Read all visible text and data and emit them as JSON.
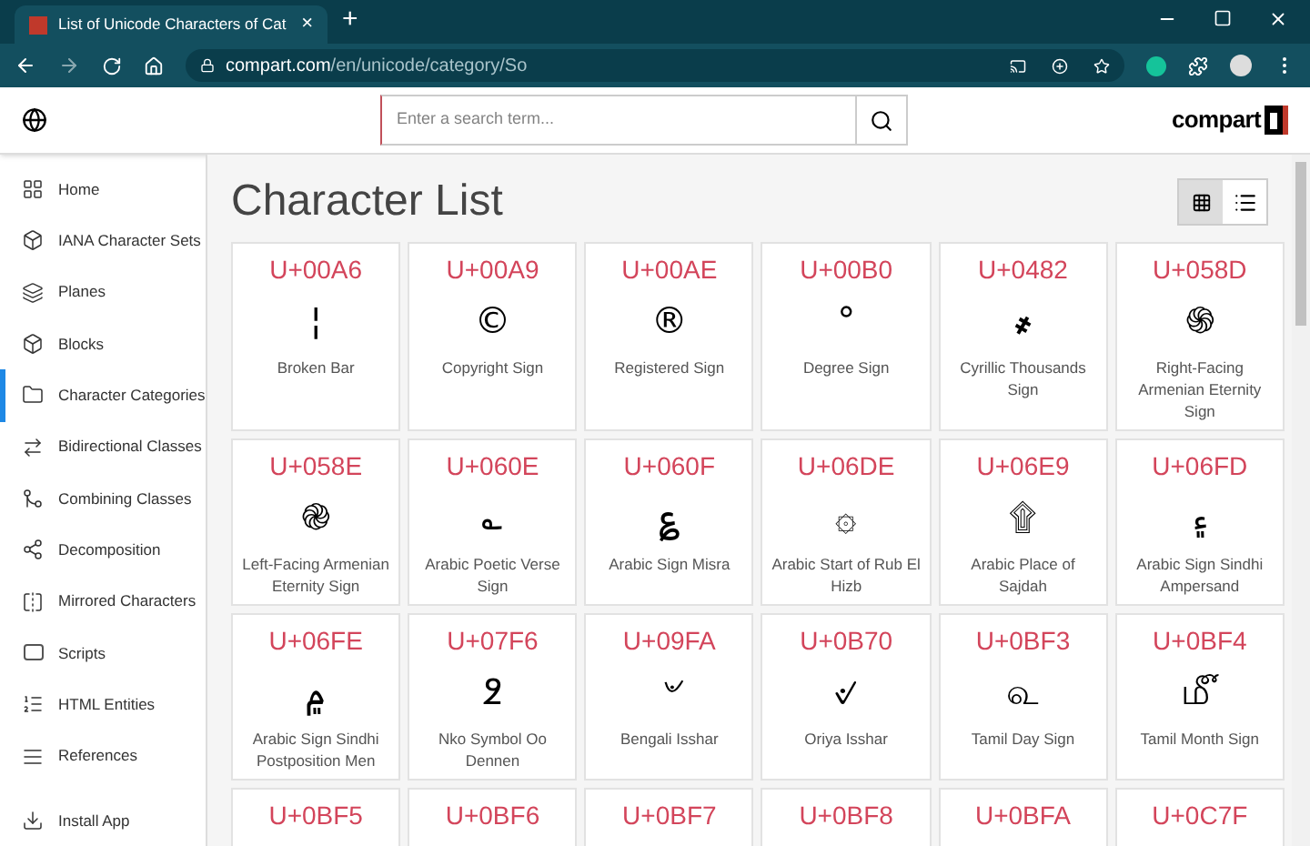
{
  "browser": {
    "tab_title": "List of Unicode Characters of Cat",
    "tab_close": "×",
    "new_tab": "+",
    "url_host": "compart.com",
    "url_path": "/en/unicode/category/So"
  },
  "header": {
    "search": {
      "placeholder": "Enter a search term..."
    },
    "logo": "compart"
  },
  "sidebar": {
    "items": [
      {
        "label": "Home",
        "selected": false,
        "kind": "home"
      },
      {
        "label": "IANA Character Sets",
        "selected": false,
        "kind": "iana"
      },
      {
        "label": "Planes",
        "selected": false,
        "kind": "planes"
      },
      {
        "label": "Blocks",
        "selected": false,
        "kind": "blocks"
      },
      {
        "label": "Character Categories",
        "selected": true,
        "kind": "categories"
      },
      {
        "label": "Bidirectional Classes",
        "selected": false,
        "kind": "bidi"
      },
      {
        "label": "Combining Classes",
        "selected": false,
        "kind": "combining"
      },
      {
        "label": "Decomposition",
        "selected": false,
        "kind": "decomposition"
      },
      {
        "label": "Mirrored Characters",
        "selected": false,
        "kind": "mirrored"
      },
      {
        "label": "Scripts",
        "selected": false,
        "kind": "scripts"
      },
      {
        "label": "HTML Entities",
        "selected": false,
        "kind": "html"
      },
      {
        "label": "References",
        "selected": false,
        "kind": "references"
      },
      {
        "label": "Install App",
        "selected": false,
        "kind": "install"
      }
    ]
  },
  "main": {
    "title": "Character List",
    "views": [
      {
        "kind": "grid",
        "selected": true
      },
      {
        "kind": "list",
        "selected": false
      }
    ],
    "cards": [
      {
        "code": "U+00A6",
        "glyph": "¦",
        "name": "Broken Bar"
      },
      {
        "code": "U+00A9",
        "glyph": "©",
        "name": "Copyright Sign"
      },
      {
        "code": "U+00AE",
        "glyph": "®",
        "name": "Registered Sign"
      },
      {
        "code": "U+00B0",
        "glyph": "°",
        "name": "Degree Sign"
      },
      {
        "code": "U+0482",
        "glyph": "҂",
        "name": "Cyrillic Thousands Sign"
      },
      {
        "code": "U+058D",
        "glyph": "֍",
        "name": "Right-Facing Armenian Eternity Sign"
      },
      {
        "code": "U+058E",
        "glyph": "֎",
        "name": "Left-Facing Armenian Eternity Sign"
      },
      {
        "code": "U+060E",
        "glyph": "؎",
        "name": "Arabic Poetic Verse Sign"
      },
      {
        "code": "U+060F",
        "glyph": "؏",
        "name": "Arabic Sign Misra"
      },
      {
        "code": "U+06DE",
        "glyph": "۞",
        "name": "Arabic Start of Rub El Hizb"
      },
      {
        "code": "U+06E9",
        "glyph": "۩",
        "name": "Arabic Place of Sajdah"
      },
      {
        "code": "U+06FD",
        "glyph": "۽",
        "name": "Arabic Sign Sindhi Ampersand"
      },
      {
        "code": "U+06FE",
        "glyph": "۾",
        "name": "Arabic Sign Sindhi Postposition Men"
      },
      {
        "code": "U+07F6",
        "glyph": "߶",
        "name": "Nko Symbol Oo Dennen"
      },
      {
        "code": "U+09FA",
        "glyph": "৺",
        "name": "Bengali Isshar"
      },
      {
        "code": "U+0B70",
        "glyph": "୰",
        "name": "Oriya Isshar"
      },
      {
        "code": "U+0BF3",
        "glyph": "௳",
        "name": "Tamil Day Sign"
      },
      {
        "code": "U+0BF4",
        "glyph": "௴",
        "name": "Tamil Month Sign"
      },
      {
        "code": "U+0BF5"
      },
      {
        "code": "U+0BF6"
      },
      {
        "code": "U+0BF7"
      },
      {
        "code": "U+0BF8"
      },
      {
        "code": "U+0BFA"
      },
      {
        "code": "U+0C7F"
      }
    ]
  }
}
